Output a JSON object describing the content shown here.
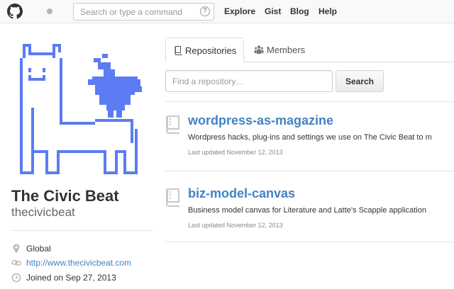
{
  "header": {
    "search_placeholder": "Search or type a command",
    "help_glyph": "?",
    "nav": [
      {
        "label": "Explore"
      },
      {
        "label": "Gist"
      },
      {
        "label": "Blog"
      },
      {
        "label": "Help"
      }
    ]
  },
  "profile": {
    "name": "The Civic Beat",
    "login": "thecivicbeat",
    "location": "Global",
    "website": "http://www.thecivicbeat.com",
    "joined": "Joined on Sep 27, 2013"
  },
  "tabs": [
    {
      "label": "Repositories",
      "icon": "repo-book-icon",
      "active": true
    },
    {
      "label": "Members",
      "icon": "members-icon",
      "active": false
    }
  ],
  "filter": {
    "placeholder": "Find a repository…",
    "button_label": "Search"
  },
  "repos": [
    {
      "name": "wordpress-as-magazine",
      "description": "Wordpress hacks, plug-ins and settings we use on The Civic Beat to m",
      "updated": "Last updated November 12, 2013"
    },
    {
      "name": "biz-model-canvas",
      "description": "Business model canvas for Literature and Latte's Scapple application",
      "updated": "Last updated November 12, 2013"
    }
  ],
  "colors": {
    "link": "#4183c4",
    "avatar_blue": "#5b7cf2"
  }
}
